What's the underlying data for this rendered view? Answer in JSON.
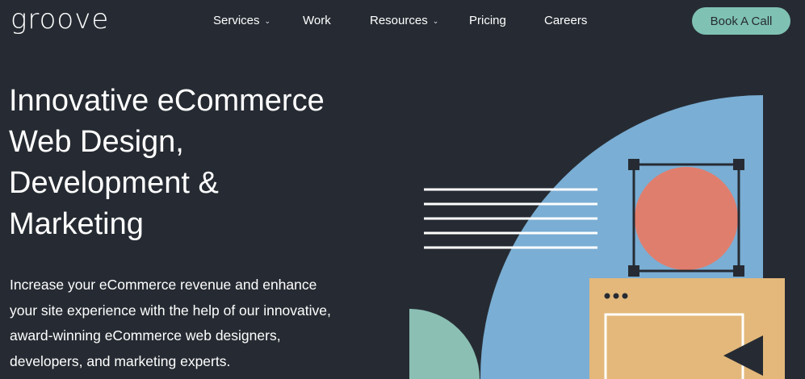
{
  "brand": {
    "logo_text": "groove"
  },
  "nav": {
    "items": [
      {
        "label": "Services",
        "has_dropdown": true
      },
      {
        "label": "Work",
        "has_dropdown": false
      },
      {
        "label": "Resources",
        "has_dropdown": true
      },
      {
        "label": "Pricing",
        "has_dropdown": false
      },
      {
        "label": "Careers",
        "has_dropdown": false
      }
    ],
    "dropdown_icon": "chevron-down-icon",
    "cta_label": "Book A Call"
  },
  "hero": {
    "title": "Innovative eCommerce Web Design, Development & Marketing",
    "subtitle": "Increase your eCommerce revenue and enhance your site experience with the help of our innovative, award-winning eCommerce web designers, developers, and marketing experts."
  },
  "colors": {
    "background": "#262b33",
    "cta_bg": "#7fc2b3",
    "illus_blue": "#7aaed4",
    "illus_coral": "#e07e6e",
    "illus_teal": "#8bbfb4",
    "illus_tan": "#e3b87a"
  }
}
